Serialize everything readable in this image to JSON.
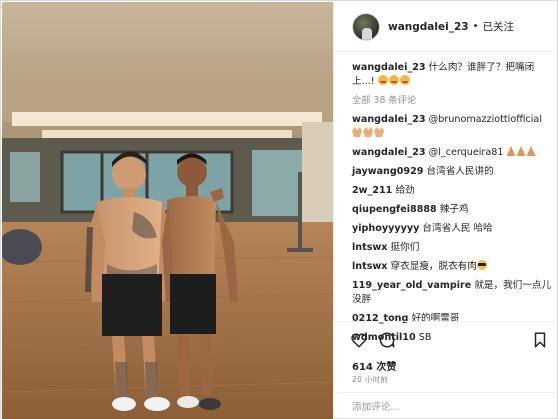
{
  "post": {
    "username": "wangdalei_23",
    "separator": "•",
    "follow_status": "已关注"
  },
  "caption": {
    "username": "wangdalei_23",
    "text": "什么肉？谁胖了？把嘴闭上...!"
  },
  "load_more": "全部 38 条评论",
  "comments": [
    {
      "username": "wangdalei_23",
      "text": "@brunomazziottiofficial",
      "icon": "clap-icon"
    },
    {
      "username": "wangdalei_23",
      "text": "@l_cerqueira81",
      "icon": "pray-icon"
    },
    {
      "username": "jaywang0929",
      "text": "台湾省人民讲的",
      "icon": ""
    },
    {
      "username": "2w_211",
      "text": "给劲",
      "icon": ""
    },
    {
      "username": "qiupengfei8888",
      "text": "辣子鸡",
      "icon": ""
    },
    {
      "username": "yiphoyyyyyy",
      "text": "台湾省人民 哈哈",
      "icon": ""
    },
    {
      "username": "lntswx",
      "text": "挺你们",
      "icon": ""
    },
    {
      "username": "lntswx",
      "text": "穿衣显瘦，脱衣有肉",
      "icon": "sunglasses-icon"
    },
    {
      "username": "119_year_old_vampire",
      "text": "就是，我们一点儿没胖",
      "icon": ""
    },
    {
      "username": "0212_tong",
      "text": "好的啊雷哥",
      "icon": ""
    },
    {
      "username": "wdmontil10",
      "text": "SB",
      "icon": ""
    }
  ],
  "actions": {
    "like_icon": "heart-icon",
    "comment_icon": "comment-icon",
    "save_icon": "bookmark-icon"
  },
  "likes": "614 次赞",
  "timestamp": "20 小时前",
  "add_comment": {
    "placeholder": "添加评论..."
  },
  "colors": {
    "text": "#262626",
    "muted": "#8e8e8e",
    "border": "#efefef",
    "floor": "#a0734a"
  }
}
